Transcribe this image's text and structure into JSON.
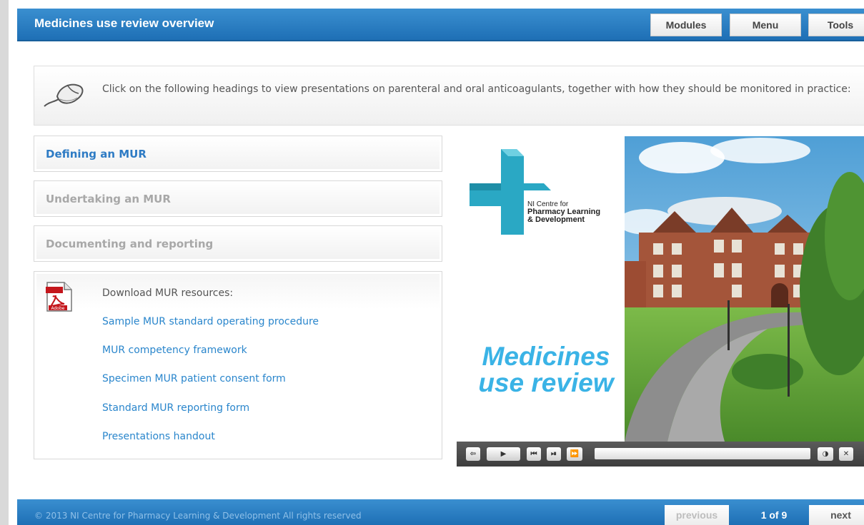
{
  "header": {
    "title": "Medicines use review overview",
    "nav": [
      "Modules",
      "Menu",
      "Tools"
    ]
  },
  "instruction": {
    "text": "Click on the following headings to view presentations on parenteral and oral anticoagulants, together with how they should be monitored in practice:",
    "icon": "mouse-icon"
  },
  "headings": [
    {
      "label": "Defining an MUR",
      "state": "active"
    },
    {
      "label": "Undertaking an MUR",
      "state": "inactive"
    },
    {
      "label": "Documenting and reporting",
      "state": "inactive"
    }
  ],
  "resources": {
    "icon": "pdf-icon",
    "icon_text": "Adobe",
    "heading": "Download MUR resources:",
    "links": [
      "Sample MUR standard operating procedure",
      "MUR competency framework",
      "Specimen MUR patient consent form",
      "Standard MUR reporting form",
      "Presentations handout"
    ]
  },
  "video": {
    "logo_line1": "NI Centre for",
    "logo_line2": "Pharmacy Learning",
    "logo_line3": "& Development",
    "promo_line1": "Medicines",
    "promo_line2": "use review",
    "controls": [
      "exit-icon",
      "play-icon",
      "skip-back-icon",
      "step-forward-icon",
      "fast-forward-icon",
      "volume-icon",
      "close-icon"
    ]
  },
  "footer": {
    "copyright": "© 2013 NI Centre for Pharmacy Learning & Development All rights reserved",
    "previous": "previous",
    "page": "1 of 9",
    "next": "next"
  },
  "colors": {
    "header_blue": "#2a7dc0",
    "link_blue": "#2a86cc",
    "promo_cyan": "#3ab3e6",
    "logo_teal": "#29a9c6"
  }
}
